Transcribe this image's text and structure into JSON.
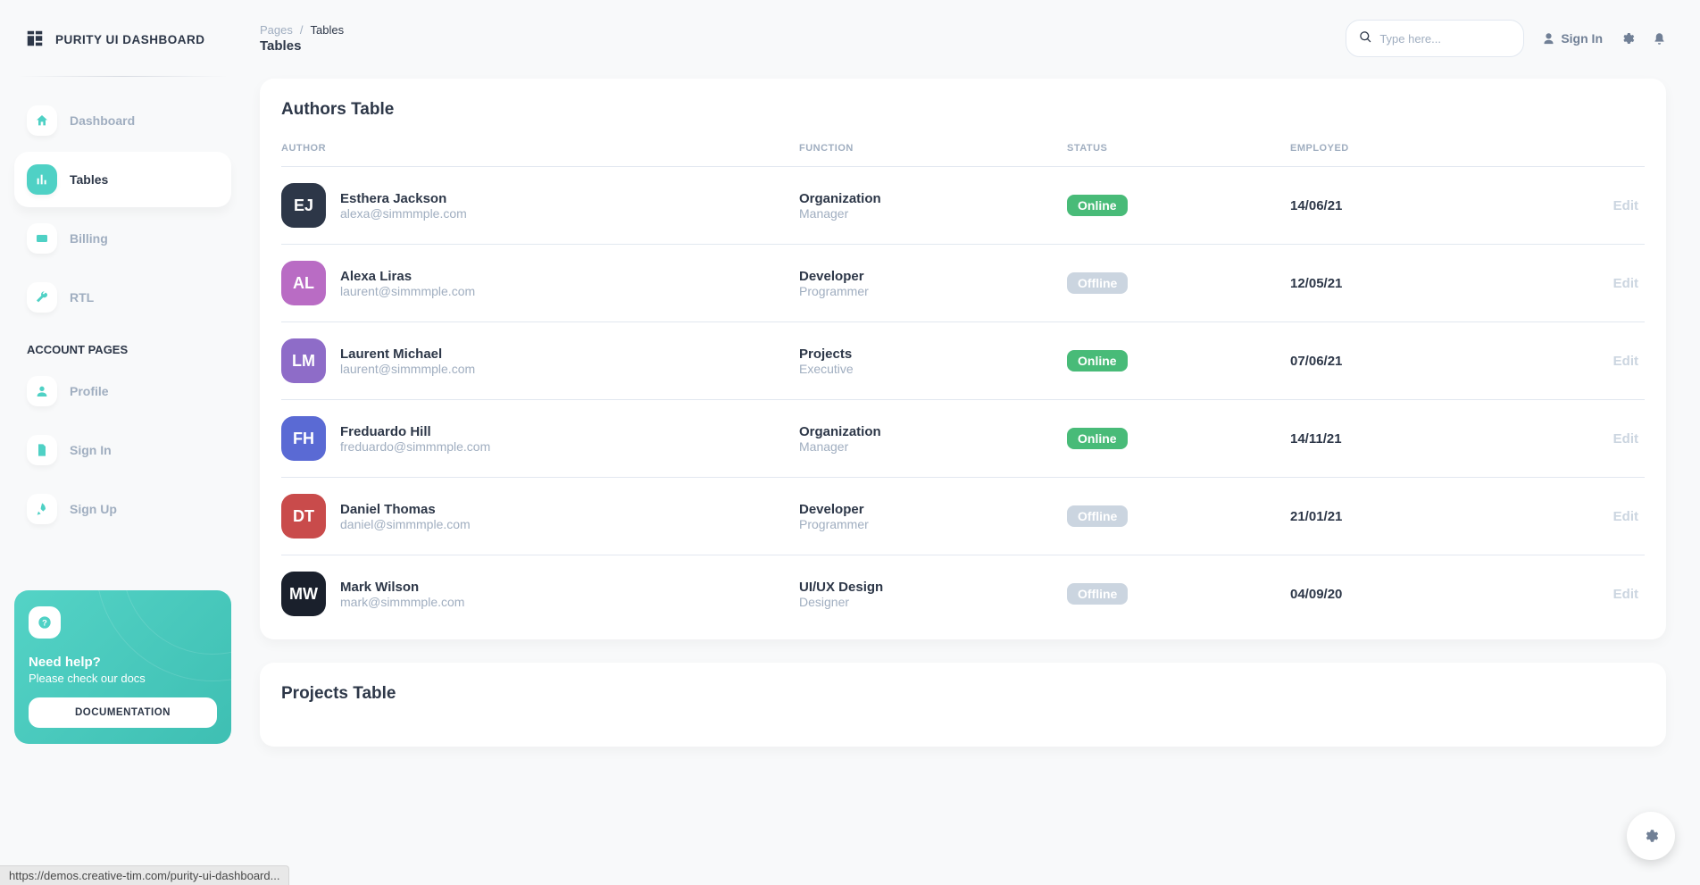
{
  "brand": {
    "title": "PURITY UI DASHBOARD"
  },
  "sidebar": {
    "items": [
      {
        "label": "Dashboard"
      },
      {
        "label": "Tables"
      },
      {
        "label": "Billing"
      },
      {
        "label": "RTL"
      }
    ],
    "account_heading": "ACCOUNT PAGES",
    "account_items": [
      {
        "label": "Profile"
      },
      {
        "label": "Sign In"
      },
      {
        "label": "Sign Up"
      }
    ],
    "help": {
      "title": "Need help?",
      "subtitle": "Please check our docs",
      "button": "DOCUMENTATION"
    }
  },
  "header": {
    "breadcrumb_root": "Pages",
    "breadcrumb_sep": "/",
    "breadcrumb_current": "Tables",
    "page_title": "Tables",
    "search_placeholder": "Type here...",
    "signin_label": "Sign In"
  },
  "authors_table": {
    "title": "Authors Table",
    "columns": {
      "author": "AUTHOR",
      "function": "FUNCTION",
      "status": "STATUS",
      "employed": "EMPLOYED"
    },
    "edit_label": "Edit",
    "rows": [
      {
        "name": "Esthera Jackson",
        "email": "alexa@simmmple.com",
        "function": "Organization",
        "subfunction": "Manager",
        "status": "Online",
        "employed": "14/06/21",
        "avatar_bg": "#2D3748"
      },
      {
        "name": "Alexa Liras",
        "email": "laurent@simmmple.com",
        "function": "Developer",
        "subfunction": "Programmer",
        "status": "Offline",
        "employed": "12/05/21",
        "avatar_bg": "#B96CC4"
      },
      {
        "name": "Laurent Michael",
        "email": "laurent@simmmple.com",
        "function": "Projects",
        "subfunction": "Executive",
        "status": "Online",
        "employed": "07/06/21",
        "avatar_bg": "#8E6CC8"
      },
      {
        "name": "Freduardo Hill",
        "email": "freduardo@simmmple.com",
        "function": "Organization",
        "subfunction": "Manager",
        "status": "Online",
        "employed": "14/11/21",
        "avatar_bg": "#5A6AD4"
      },
      {
        "name": "Daniel Thomas",
        "email": "daniel@simmmple.com",
        "function": "Developer",
        "subfunction": "Programmer",
        "status": "Offline",
        "employed": "21/01/21",
        "avatar_bg": "#C94B4B"
      },
      {
        "name": "Mark Wilson",
        "email": "mark@simmmple.com",
        "function": "UI/UX Design",
        "subfunction": "Designer",
        "status": "Offline",
        "employed": "04/09/20",
        "avatar_bg": "#1A202C"
      }
    ]
  },
  "projects_table": {
    "title": "Projects Table"
  },
  "status_url": "https://demos.creative-tim.com/purity-ui-dashboard..."
}
